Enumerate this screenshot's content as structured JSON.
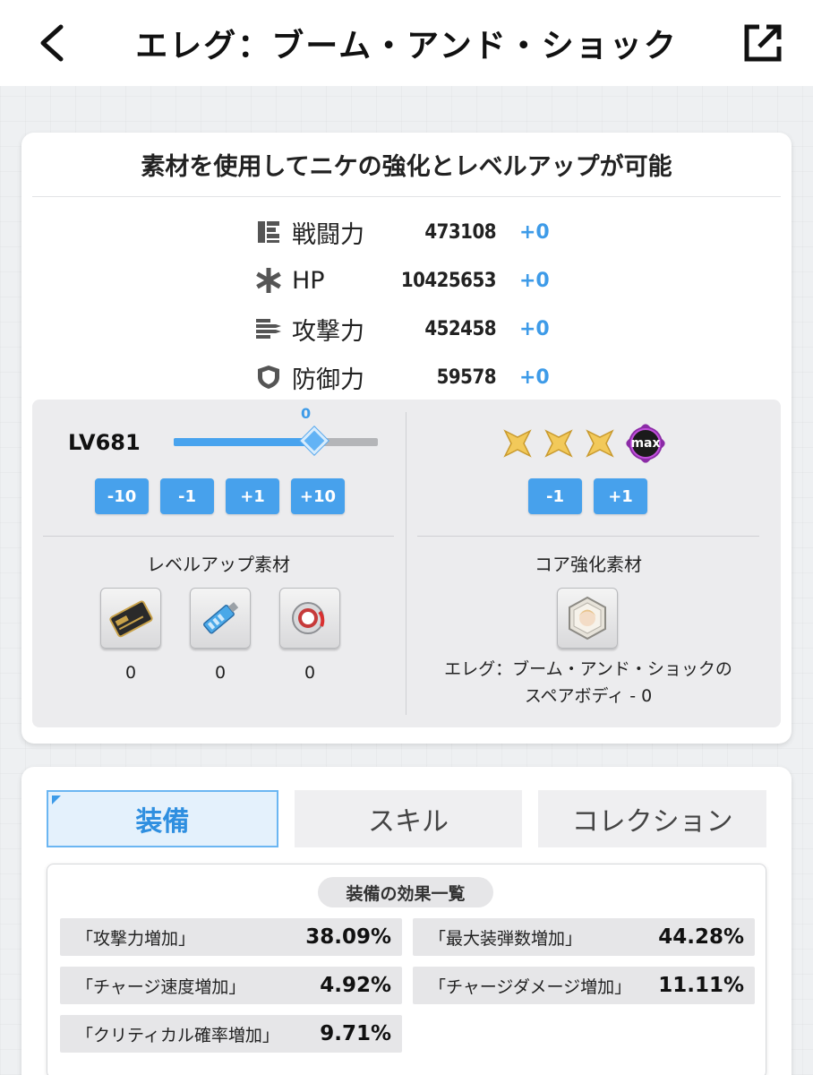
{
  "header": {
    "title": "エレグ：ブーム・アンド・ショック"
  },
  "card": {
    "heading": "素材を使用してニケの強化とレベルアップが可能",
    "stats": [
      {
        "icon": "power-icon",
        "label": "戦闘力",
        "value": "473108",
        "delta": "+0"
      },
      {
        "icon": "asterisk-icon",
        "label": "HP",
        "value": "10425653",
        "delta": "+0"
      },
      {
        "icon": "attack-icon",
        "label": "攻撃力",
        "value": "452458",
        "delta": "+0"
      },
      {
        "icon": "shield-icon",
        "label": "防御力",
        "value": "59578",
        "delta": "+0"
      }
    ]
  },
  "level": {
    "text": "LV681",
    "slider_value": "0",
    "slider_fraction": 0.69,
    "buttons": [
      "-10",
      "-1",
      "+1",
      "+10"
    ]
  },
  "core": {
    "stars": 3,
    "max_label": "max",
    "buttons": [
      "-1",
      "+1"
    ],
    "colors": {
      "star": "#f2c95a",
      "max_badge": "#8b2ba6"
    }
  },
  "materials": {
    "title": "レベルアップ素材",
    "items": [
      {
        "icon": "credit-card-icon",
        "count": "0"
      },
      {
        "icon": "battle-data-icon",
        "count": "0"
      },
      {
        "icon": "core-dust-icon",
        "count": "0"
      }
    ]
  },
  "core_materials": {
    "title": "コア強化素材",
    "icon": "spare-body-icon",
    "line1": "エレグ：ブーム・アンド・ショックの",
    "line2": "スペアボディ - 0"
  },
  "tabs": [
    {
      "label": "装備",
      "active": true
    },
    {
      "label": "スキル",
      "active": false
    },
    {
      "label": "コレクション",
      "active": false
    }
  ],
  "effects": {
    "title": "装備の効果一覧",
    "items": [
      {
        "label": "「攻撃力増加」",
        "value": "38.09%"
      },
      {
        "label": "「最大装弾数増加」",
        "value": "44.28%"
      },
      {
        "label": "「チャージ速度増加」",
        "value": "4.92%"
      },
      {
        "label": "「チャージダメージ増加」",
        "value": "11.11%"
      },
      {
        "label": "「クリティカル確率増加」",
        "value": "9.71%"
      }
    ]
  },
  "colors": {
    "accent": "#47a1ec",
    "delta": "#3e9be8"
  }
}
